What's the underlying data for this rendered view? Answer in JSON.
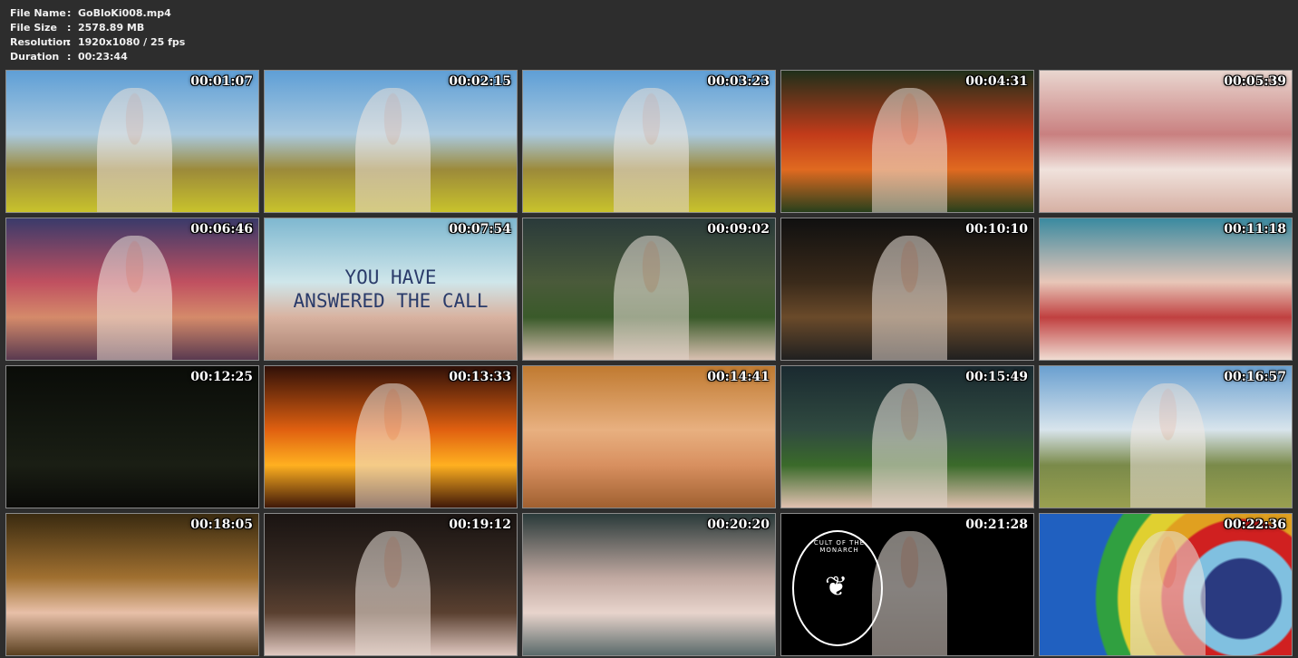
{
  "file_info": {
    "rows": [
      {
        "label": "File Name",
        "value": "GoBloKi008.mp4"
      },
      {
        "label": "File Size",
        "value": "2578.89 MB"
      },
      {
        "label": "Resolution",
        "value": "1920x1080 / 25 fps"
      },
      {
        "label": "Duration",
        "value": "00:23:44"
      }
    ],
    "separator": ":"
  },
  "thumbnails": [
    {
      "time": "00:01:07",
      "scene": "field",
      "figure": true
    },
    {
      "time": "00:02:15",
      "scene": "field",
      "figure": true
    },
    {
      "time": "00:03:23",
      "scene": "field",
      "figure": true
    },
    {
      "time": "00:04:31",
      "scene": "flowers",
      "figure": true
    },
    {
      "time": "00:05:39",
      "scene": "closeup-lips",
      "figure": false
    },
    {
      "time": "00:06:46",
      "scene": "sunset",
      "figure": true
    },
    {
      "time": "00:07:54",
      "scene": "sky-text",
      "figure": false,
      "overlay_lines": [
        "YOU HAVE",
        "ANSWERED THE CALL"
      ]
    },
    {
      "time": "00:09:02",
      "scene": "forest",
      "figure": true
    },
    {
      "time": "00:10:10",
      "scene": "dark-forest",
      "figure": true
    },
    {
      "time": "00:11:18",
      "scene": "butterfly-closeup",
      "figure": false
    },
    {
      "time": "00:12:25",
      "scene": "night",
      "figure": false
    },
    {
      "time": "00:13:33",
      "scene": "fire",
      "figure": true
    },
    {
      "time": "00:14:41",
      "scene": "eyes-closeup",
      "figure": false
    },
    {
      "time": "00:15:49",
      "scene": "meadow",
      "figure": true
    },
    {
      "time": "00:16:57",
      "scene": "hills",
      "figure": true
    },
    {
      "time": "00:18:05",
      "scene": "butterflies",
      "figure": false
    },
    {
      "time": "00:19:12",
      "scene": "dark-sky",
      "figure": true
    },
    {
      "time": "00:20:20",
      "scene": "close-lace",
      "figure": false
    },
    {
      "time": "00:21:28",
      "scene": "cult-badge",
      "figure": true,
      "badge_text": "CULT OF THE MONARCH"
    },
    {
      "time": "00:22:36",
      "scene": "rainbow",
      "figure": true
    }
  ],
  "scene_colors": {
    "field": [
      "#5f9fd6",
      "#a9c9df",
      "#9c8a3a",
      "#c8c22c"
    ],
    "flowers": [
      "#1f2f1a",
      "#c23b1a",
      "#e06a20",
      "#28401c"
    ],
    "closeup-lips": [
      "#e9d6cf",
      "#c98080",
      "#f0e2dc",
      "#d6b0a4"
    ],
    "sunset": [
      "#3a3a6a",
      "#c05060",
      "#d48a6a",
      "#5a3a50"
    ],
    "sky-text": [
      "#7fb8d0",
      "#cfe6ea",
      "#d8b2a0",
      "#a88070"
    ],
    "forest": [
      "#2a3a3a",
      "#4a5a3a",
      "#3a5a2a",
      "#d8c0b0"
    ],
    "dark-forest": [
      "#101010",
      "#3a2a1a",
      "#6a4a2a",
      "#202020"
    ],
    "butterfly-closeup": [
      "#3a8aa0",
      "#e8c6b8",
      "#c04040",
      "#f0dcd2"
    ],
    "night": [
      "#0a0c08",
      "#141810",
      "#1a1e14",
      "#0a0a08"
    ],
    "fire": [
      "#301008",
      "#e06010",
      "#ffb020",
      "#401808"
    ],
    "eyes-closeup": [
      "#c07a30",
      "#e8b080",
      "#d89060",
      "#a06030"
    ],
    "meadow": [
      "#1a2a30",
      "#304a40",
      "#3a6a2a",
      "#e0c0b0"
    ],
    "hills": [
      "#6aa0d0",
      "#d8e4ec",
      "#7a8a4a",
      "#9aa050"
    ],
    "butterflies": [
      "#3a2a10",
      "#a07030",
      "#e8c0a8",
      "#5a4020"
    ],
    "dark-sky": [
      "#1a1412",
      "#3a2c24",
      "#5a4030",
      "#e0c8c0"
    ],
    "close-lace": [
      "#2a3a3a",
      "#c0a8a0",
      "#e8d4cc",
      "#5a6a6a"
    ],
    "cult-badge": [
      "#000000",
      "#000000",
      "#2a2020",
      "#e0c0b0"
    ],
    "rainbow": [
      "#d02020",
      "#e0a020",
      "#2060c0",
      "#30a040"
    ]
  },
  "badge_icon": "butterfly-icon"
}
